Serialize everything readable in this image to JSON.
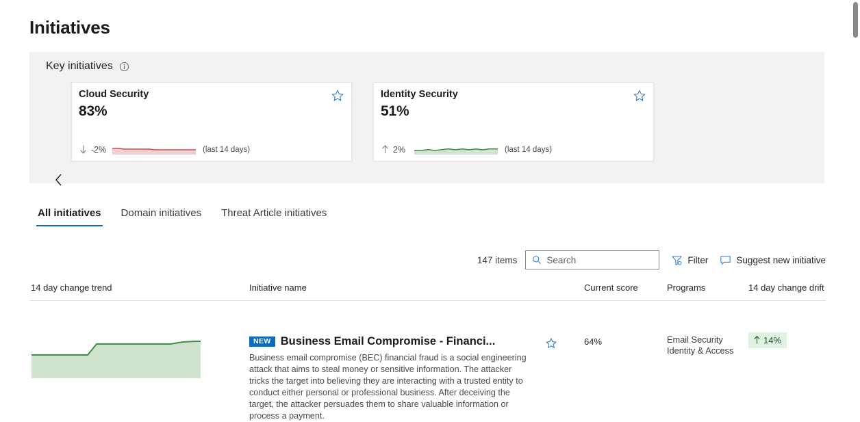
{
  "page": {
    "title": "Initiatives"
  },
  "key_initiatives": {
    "label": "Key initiatives",
    "info_icon": "info-icon",
    "prev_icon": "chevron-left-icon",
    "cards": [
      {
        "title": "Cloud Security",
        "score": "83%",
        "delta": "-2%",
        "direction": "down",
        "period": "(last 14 days)",
        "star_icon": "star-outline-icon",
        "trend_color": "#c94f4f",
        "trend_fill": "#f2cfcf"
      },
      {
        "title": "Identity Security",
        "score": "51%",
        "delta": "2%",
        "direction": "up",
        "period": "(last 14 days)",
        "star_icon": "star-outline-icon",
        "trend_color": "#3c8a41",
        "trend_fill": "#cfe3cf"
      }
    ]
  },
  "tabs": [
    {
      "label": "All initiatives",
      "active": true
    },
    {
      "label": "Domain initiatives",
      "active": false
    },
    {
      "label": "Threat Article initiatives",
      "active": false
    }
  ],
  "toolbar": {
    "items_count": "147 items",
    "search_placeholder": "Search",
    "search_value": "",
    "search_icon": "search-icon",
    "filter_label": "Filter",
    "filter_icon": "filter-icon",
    "suggest_label": "Suggest new initiative",
    "suggest_icon": "comment-icon"
  },
  "table": {
    "columns": [
      "14 day change trend",
      "Initiative name",
      "Current score",
      "Programs",
      "14 day change drift"
    ],
    "rows": [
      {
        "badge": "NEW",
        "title": "Business Email Compromise - Financi...",
        "description": "Business email compromise (BEC) financial fraud is a social engineering attack that aims to steal money or sensitive information. The attacker tricks the target into believing they are interacting with a trusted entity to conduct either personal or professional business. After deceiving the target, the attacker persuades them to share valuable information or process a payment.",
        "current_score": "64%",
        "programs": "Email Security\nIdentity & Access",
        "drift": "14%",
        "drift_direction": "up",
        "star_icon": "star-outline-icon"
      }
    ]
  },
  "chart_data": [
    {
      "type": "area",
      "name": "row-14-day-change-trend",
      "title": "14 day change trend",
      "x": [
        0,
        1,
        2,
        3,
        4,
        5,
        6,
        7,
        8,
        9,
        10,
        11,
        12,
        13
      ],
      "values": [
        50,
        50,
        50,
        50,
        64,
        64,
        64,
        64,
        64,
        64,
        64,
        64,
        65,
        66
      ],
      "ylim": [
        0,
        100
      ],
      "grid": false,
      "line_color": "#3f8d42",
      "fill_color": "#cfe3cf"
    },
    {
      "type": "area",
      "name": "cloud-security-sparkline",
      "title": "Cloud Security last 14 days",
      "x": [
        0,
        1,
        2,
        3,
        4,
        5,
        6,
        7,
        8,
        9,
        10,
        11,
        12,
        13
      ],
      "values": [
        85,
        85,
        84,
        84,
        84,
        84,
        84,
        83,
        83,
        83,
        83,
        83,
        83,
        83
      ],
      "ylim": [
        0,
        100
      ],
      "grid": false,
      "line_color": "#c94f4f",
      "fill_color": "#f2cfcf"
    },
    {
      "type": "area",
      "name": "identity-security-sparkline",
      "title": "Identity Security last 14 days",
      "x": [
        0,
        1,
        2,
        3,
        4,
        5,
        6,
        7,
        8,
        9,
        10,
        11,
        12,
        13
      ],
      "values": [
        49,
        49,
        50,
        49,
        50,
        51,
        50,
        51,
        50,
        51,
        50,
        51,
        51,
        51
      ],
      "ylim": [
        0,
        100
      ],
      "grid": false,
      "line_color": "#3c8a41",
      "fill_color": "#cfe3cf"
    }
  ],
  "colors": {
    "accent": "#0f6cbd",
    "banner_bg": "#f3f2f1",
    "positive": "#3c8a41",
    "negative": "#c94f4f"
  }
}
